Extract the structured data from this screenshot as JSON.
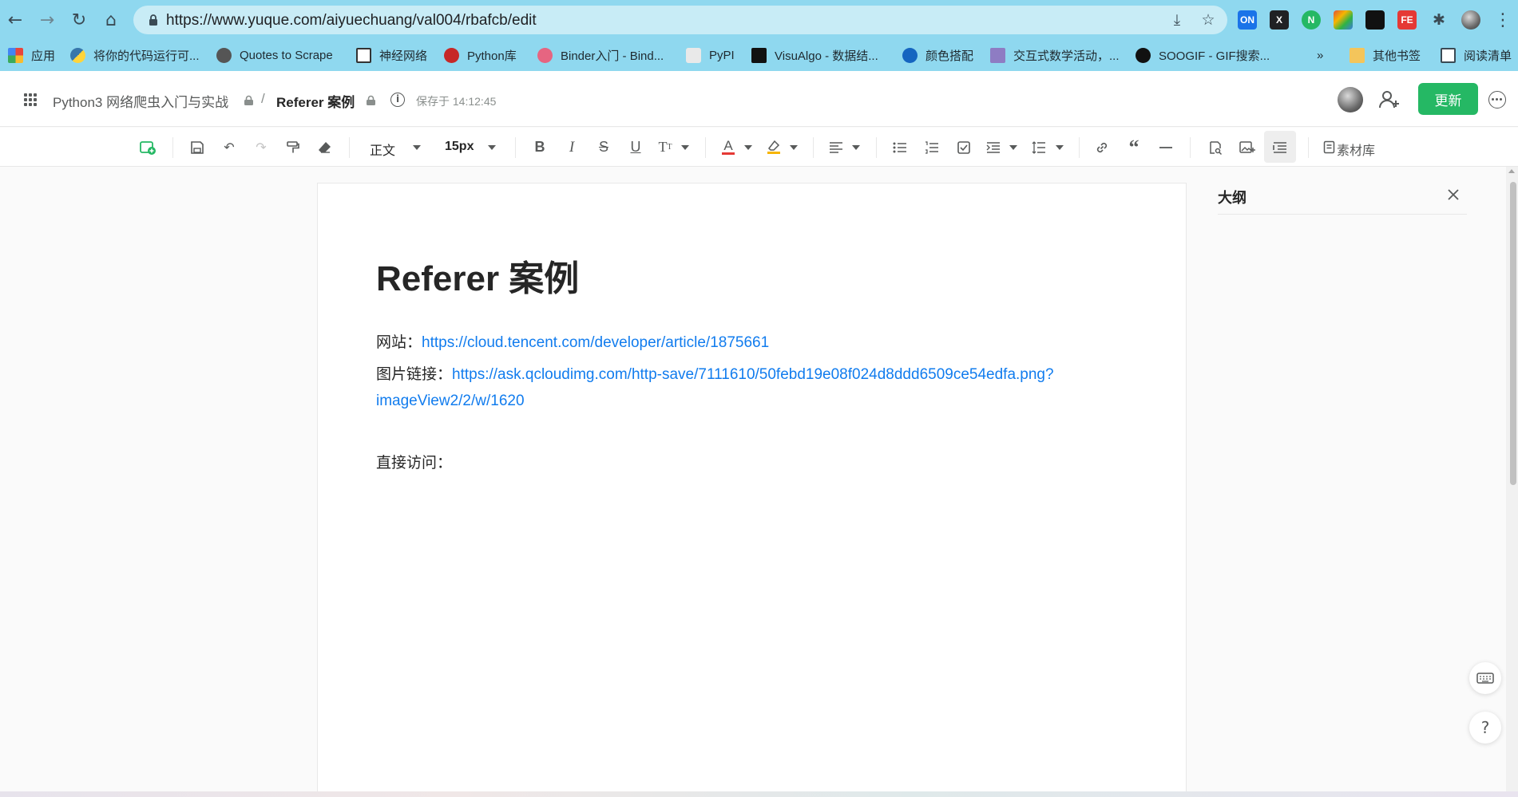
{
  "browser": {
    "url": "https://www.yuque.com/aiyuechuang/val004/rbafcb/edit",
    "extensions": [
      {
        "name": "on-extension-icon",
        "label": "ON",
        "color": "#1a73e8"
      },
      {
        "name": "x-extension-icon",
        "label": "X",
        "color": "#202124"
      },
      {
        "name": "n-extension-icon",
        "label": "N",
        "color": "#25b864"
      },
      {
        "name": "color-extension-icon",
        "label": "",
        "color": "#e0533a"
      },
      {
        "name": "glasses-extension-icon",
        "label": "",
        "color": "#111111"
      },
      {
        "name": "fe-extension-icon",
        "label": "FE",
        "color": "#e53935"
      }
    ],
    "bookmarks": [
      {
        "label": "应用",
        "icon": "apps-grid-icon",
        "color": "#e8453c"
      },
      {
        "label": "将你的代码运行可...",
        "icon": "python-icon",
        "color": "#3776ab"
      },
      {
        "label": "Quotes to Scrape",
        "icon": "globe-icon",
        "color": "#555555"
      },
      {
        "label": "神经网络",
        "icon": "spiral-icon",
        "color": "#333333"
      },
      {
        "label": "Python库",
        "icon": "x-red-icon",
        "color": "#c62828"
      },
      {
        "label": "Binder入门 - Bind...",
        "icon": "binder-icon",
        "color": "#e66581"
      },
      {
        "label": "PyPI",
        "icon": "package-icon",
        "color": "#d9d9d9"
      },
      {
        "label": "VisuAlgo - 数据结...",
        "icon": "visualgo-icon",
        "color": "#111111"
      },
      {
        "label": "颜色搭配",
        "icon": "c-blue-icon",
        "color": "#1565c0"
      },
      {
        "label": "交互式数学活动，...",
        "icon": "math-icon",
        "color": "#8e7cc3"
      },
      {
        "label": "SOOGIF - GIF搜索...",
        "icon": "soogif-icon",
        "color": "#111111"
      }
    ],
    "bookmarks_overflow": "»",
    "other_bookmarks": "其他书签",
    "reading_list": "阅读清单"
  },
  "header": {
    "book_name": "Python3 网络爬虫入门与实战",
    "separator": "/",
    "doc_name": "Referer 案例",
    "saved_status": "保存于 14:12:45",
    "update_label": "更新"
  },
  "toolbar": {
    "paragraph_style": "正文",
    "font_size": "15px",
    "material_library": "素材库"
  },
  "document": {
    "title": "Referer 案例",
    "site_label": "网站：",
    "site_url": "https://cloud.tencent.com/developer/article/1875661",
    "image_label": "图片链接：",
    "image_url_part1": "https://ask.qcloudimg.com/http-save/7111610/50febd19e08f024d8ddd6509ce54edfa.png?",
    "image_url_part2": "imageView2/2/w/1620",
    "direct_access": "直接访问："
  },
  "outline": {
    "title": "大纲"
  },
  "colors": {
    "chrome": "#8fd8ef",
    "accent_green": "#25b864",
    "link_blue": "#117cee"
  }
}
